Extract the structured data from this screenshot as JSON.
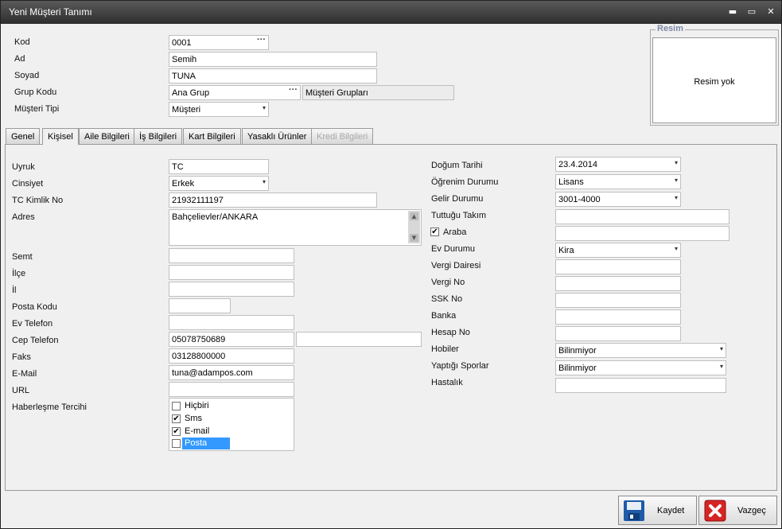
{
  "window": {
    "title": "Yeni Müşteri Tanımı",
    "minimize_icon": "▬",
    "maximize_icon": "▭",
    "close_icon": "✕"
  },
  "header": {
    "kod_label": "Kod",
    "kod_value": "0001",
    "ad_label": "Ad",
    "ad_value": "Semih",
    "soyad_label": "Soyad",
    "soyad_value": "TUNA",
    "grup_kodu_label": "Grup Kodu",
    "grup_kodu_value": "Ana Grup",
    "grup_name": "Müşteri Grupları",
    "musteri_tipi_label": "Müşteri Tipi",
    "musteri_tipi_value": "Müşteri",
    "ellipsis": "···",
    "dropdown_arrow": "▾"
  },
  "photo": {
    "group_title": "Resim",
    "placeholder": "Resim yok"
  },
  "tabs": [
    {
      "label": "Genel"
    },
    {
      "label": "Kişisel"
    },
    {
      "label": "Aile Bilgileri"
    },
    {
      "label": "İş Bilgileri"
    },
    {
      "label": "Kart Bilgileri"
    },
    {
      "label": "Yasaklı Ürünler"
    },
    {
      "label": "Kredi Bilgileri"
    }
  ],
  "left": {
    "uyruk_label": "Uyruk",
    "uyruk_value": "TC",
    "cinsiyet_label": "Cinsiyet",
    "cinsiyet_value": "Erkek",
    "tc_label": "TC Kimlik No",
    "tc_value": "21932111197",
    "adres_label": "Adres",
    "adres_value": "Bahçelievler/ANKARA",
    "semt_label": "Semt",
    "semt_value": "",
    "ilce_label": "İlçe",
    "ilce_value": "",
    "il_label": "İl",
    "il_value": "",
    "posta_kodu_label": "Posta Kodu",
    "posta_kodu_value": "",
    "ev_telefon_label": "Ev Telefon",
    "ev_telefon_value": "",
    "cep_telefon_label": "Cep Telefon",
    "cep_telefon_value": "05078750689",
    "cep_telefon2_value": "",
    "faks_label": "Faks",
    "faks_value": "03128800000",
    "email_label": "E-Mail",
    "email_value": "tuna@adampos.com",
    "url_label": "URL",
    "url_value": "",
    "haberlesme_label": "Haberleşme Tercihi",
    "haberlesme_options": [
      {
        "label": "Hiçbiri",
        "checked": ""
      },
      {
        "label": "Sms",
        "checked": "✔"
      },
      {
        "label": "E-mail",
        "checked": "✔"
      },
      {
        "label": "Posta",
        "checked": ""
      }
    ]
  },
  "right": {
    "dogum_label": "Doğum Tarihi",
    "dogum_value": "23.4.2014",
    "ogrenim_label": "Öğrenim Durumu",
    "ogrenim_value": "Lisans",
    "gelir_label": "Gelir Durumu",
    "gelir_value": "3001-4000",
    "takim_label": "Tuttuğu Takım",
    "takim_value": "",
    "araba_label": "Araba",
    "araba_checked": "✔",
    "araba_value": "",
    "ev_durumu_label": "Ev Durumu",
    "ev_durumu_value": "Kira",
    "vergi_dairesi_label": "Vergi Dairesi",
    "vergi_dairesi_value": "",
    "vergi_no_label": "Vergi No",
    "vergi_no_value": "",
    "ssk_label": "SSK No",
    "ssk_value": "",
    "banka_label": "Banka",
    "banka_value": "",
    "hesap_label": "Hesap No",
    "hesap_value": "",
    "hobiler_label": "Hobiler",
    "hobiler_value": "Bilinmiyor",
    "spor_label": "Yaptığı Sporlar",
    "spor_value": "Bilinmiyor",
    "hastalik_label": "Hastalık",
    "hastalik_value": ""
  },
  "buttons": {
    "save_label": "Kaydet",
    "cancel_label": "Vazgeç"
  },
  "colors": {
    "accent": "#3399ff",
    "save_icon": "#1e5aa8",
    "cancel_icon": "#d62424"
  }
}
